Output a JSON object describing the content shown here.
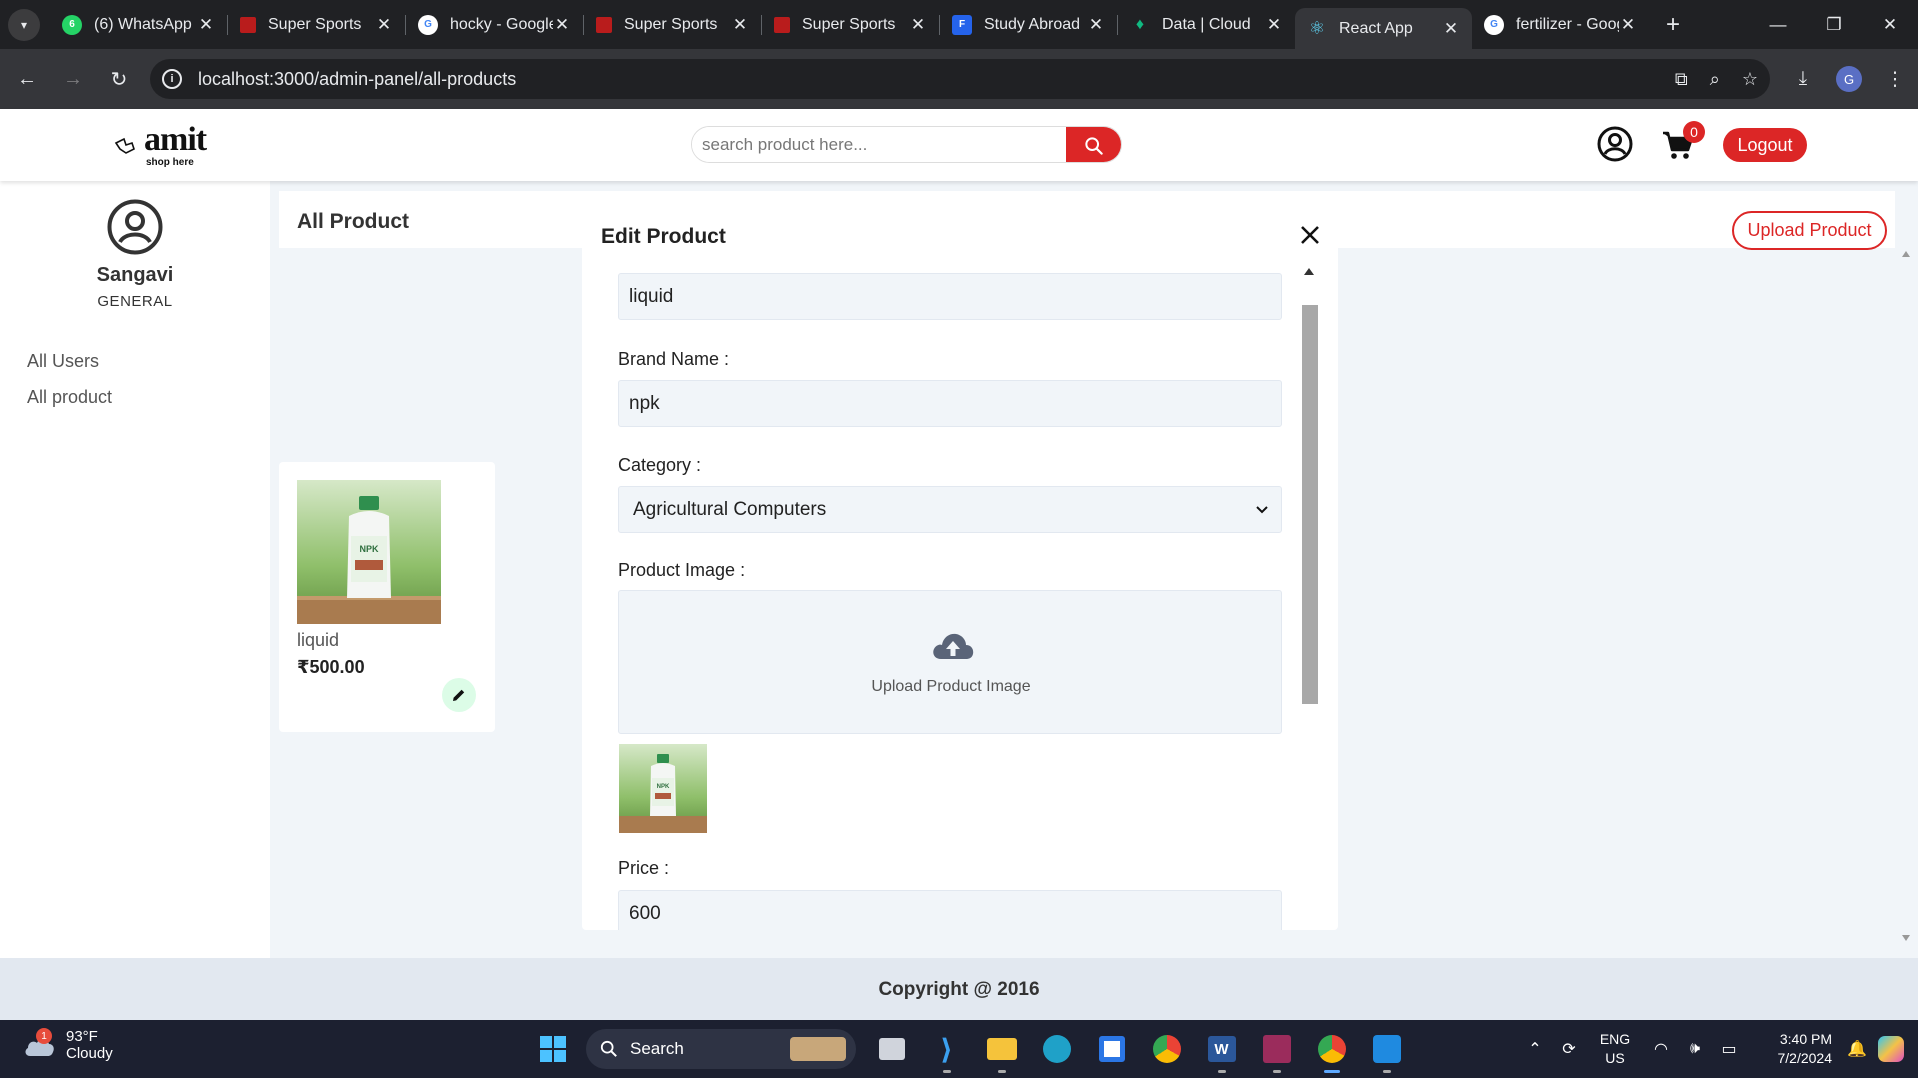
{
  "browser": {
    "tabs": [
      {
        "title": "(6) WhatsApp",
        "favicon": "whatsapp-icon",
        "color": "#25d366"
      },
      {
        "title": "Super Sports",
        "favicon": "super-sports-icon",
        "color": "#b91c1c"
      },
      {
        "title": "hocky - Google Search",
        "favicon": "google-icon",
        "color": "#ffffff"
      },
      {
        "title": "Super Sports",
        "favicon": "super-sports-icon",
        "color": "#b91c1c"
      },
      {
        "title": "Super Sports",
        "favicon": "super-sports-icon",
        "color": "#b91c1c"
      },
      {
        "title": "Study Abroad",
        "favicon": "study-abroad-icon",
        "color": "#2563eb"
      },
      {
        "title": "Data | Cloud",
        "favicon": "mongodb-icon",
        "color": "#10b981"
      },
      {
        "title": "React App",
        "favicon": "react-icon",
        "color": "#61dafb",
        "active": true
      },
      {
        "title": "fertilizer - Google Search",
        "favicon": "google-icon",
        "color": "#ffffff"
      }
    ],
    "url": "localhost:3000/admin-panel/all-products",
    "profile_initial": "G"
  },
  "header": {
    "logo_main": "amit",
    "logo_sub": "shop here",
    "search_placeholder": "search product here...",
    "cart_count": "0",
    "logout_label": "Logout"
  },
  "sidebar": {
    "user_name": "Sangavi",
    "user_role": "GENERAL",
    "nav": [
      "All Users",
      "All product"
    ]
  },
  "main": {
    "title": "All Product",
    "upload_label": "Upload Product",
    "product": {
      "name": "liquid",
      "price": "₹500.00"
    }
  },
  "modal": {
    "title": "Edit Product",
    "product_name_value": "liquid",
    "brand_label": "Brand Name :",
    "brand_value": "npk",
    "category_label": "Category :",
    "category_value": "Agricultural Computers",
    "image_label": "Product Image :",
    "upload_text": "Upload Product Image",
    "price_label": "Price :",
    "price_value": "600"
  },
  "footer": {
    "text": "Copyright @ 2016"
  },
  "taskbar": {
    "temperature": "93°F",
    "weather": "Cloudy",
    "weather_badge": "1",
    "search_label": "Search",
    "lang": "ENG",
    "region": "US",
    "time": "3:40 PM",
    "date": "7/2/2024"
  },
  "colors": {
    "accent": "#dc2626",
    "edit_bg": "#dcfce7"
  }
}
